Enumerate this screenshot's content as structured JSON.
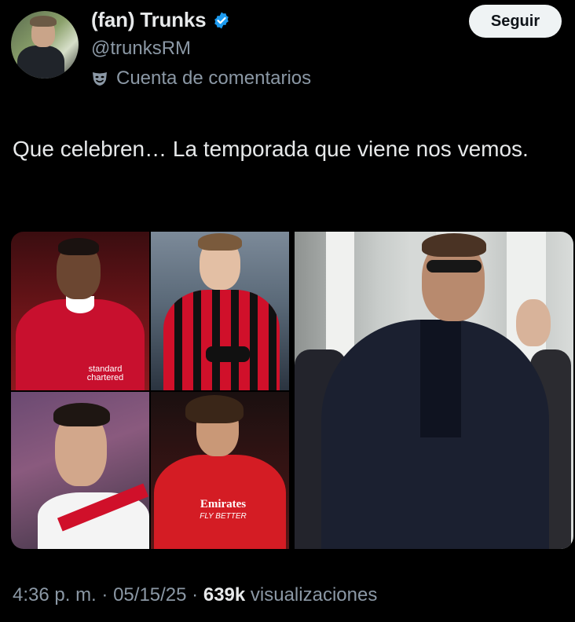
{
  "author": {
    "display_name": "(fan) Trunks",
    "handle": "@trunksRM",
    "account_label": "Cuenta de comentarios",
    "verified_color": "#1d9bf0"
  },
  "actions": {
    "follow_label": "Seguir"
  },
  "tweet": {
    "text": "Que celebren… La temporada que viene nos vemos."
  },
  "media": {
    "collage_jersey_texts": {
      "sponsor_top_left": "standard chartered",
      "sponsor_bottom_right": "Emirates",
      "sponsor_bottom_right_tag": "FLY BETTER"
    }
  },
  "meta": {
    "time": "4:36 p. m.",
    "separator": "·",
    "date": "05/15/25",
    "views_count": "639k",
    "views_label": "visualizaciones"
  },
  "colors": {
    "background": "#000000",
    "primary_text": "#e7e9ea",
    "secondary_text": "#8b98a5",
    "button_bg": "#eff3f4"
  },
  "icons": [
    "verified-badge-icon",
    "comedy-mask-icon"
  ]
}
